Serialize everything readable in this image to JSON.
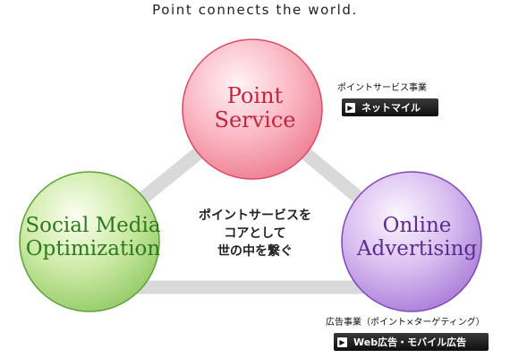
{
  "tagline": "Point connects the world.",
  "nodes": {
    "point_service": {
      "line1": "Point",
      "line2": "Service",
      "color": "#c2263e"
    },
    "social_media": {
      "line1": "Social Media",
      "line2": "Optimization",
      "color": "#2e7a1e"
    },
    "online_advertising": {
      "line1": "Online",
      "line2": "Advertising",
      "color": "#5b2d8c"
    }
  },
  "center": {
    "line1": "ポイントサービスを",
    "line2": "コアとして",
    "line3": "世の中を繋ぐ"
  },
  "point_business": {
    "caption": "ポイントサービス事業",
    "button_label": "ネットマイル"
  },
  "ad_business": {
    "caption": "広告事業（ポイント×ターゲティング）",
    "button_label": "Web広告・モバイル広告"
  },
  "colors": {
    "connector": "#d9d9d9",
    "button_bg": "#1a1a1a"
  }
}
